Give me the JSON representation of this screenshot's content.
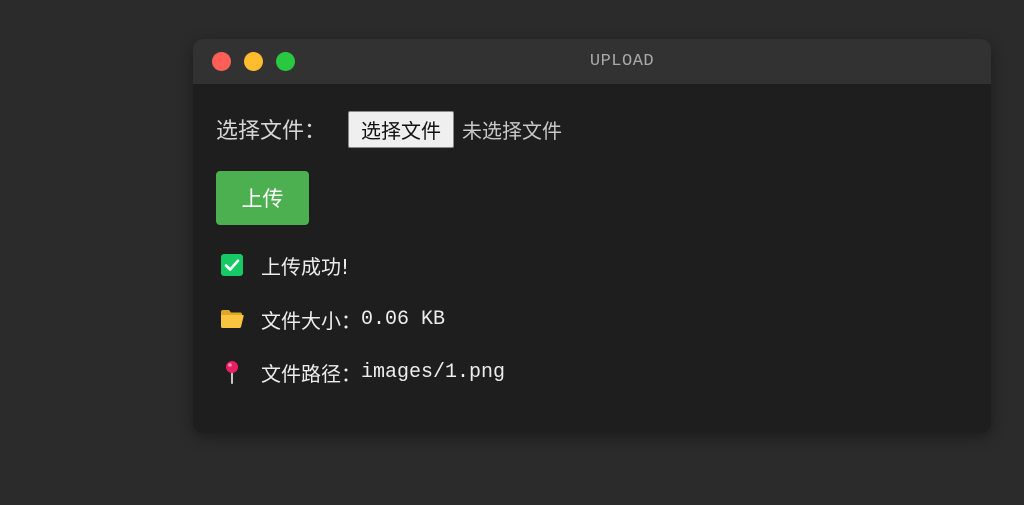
{
  "window": {
    "title": "UPLOAD",
    "controls": [
      "close",
      "minimize",
      "maximize"
    ]
  },
  "form": {
    "file_label": "选择文件：",
    "file_button_label": "选择文件",
    "file_status": "未选择文件",
    "upload_button_label": "上传"
  },
  "result": {
    "success_icon": "check-box-icon",
    "success_text": "上传成功!",
    "size_icon": "folder-icon",
    "size_label": "文件大小：",
    "size_value": "0.06 KB",
    "path_icon": "pin-icon",
    "path_label": "文件路径：",
    "path_value": "images/1.png"
  },
  "colors": {
    "background": "#2b2b2b",
    "window": "#1e1e1e",
    "titlebar": "#323232",
    "close": "#ff5f57",
    "minimize": "#febc2e",
    "maximize": "#28c840",
    "upload_button": "#4caf50",
    "success_check": "#17c964",
    "folder": "#f9c440",
    "pin": "#e91e63"
  }
}
